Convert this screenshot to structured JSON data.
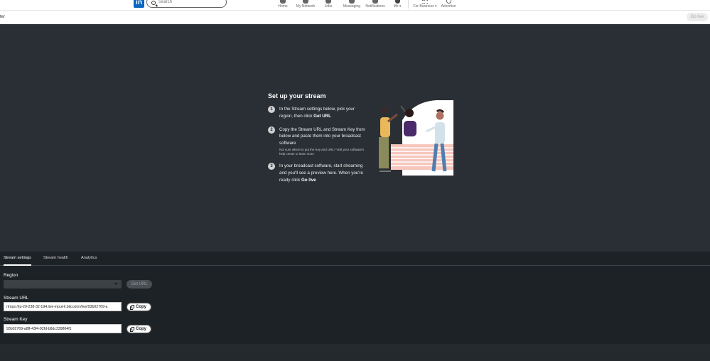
{
  "nav": {
    "logo": "in",
    "search_placeholder": "Search",
    "items": [
      {
        "label": "Home"
      },
      {
        "label": "My Network"
      },
      {
        "label": "Jobs"
      },
      {
        "label": "Messaging"
      },
      {
        "label": "Notifications"
      },
      {
        "label": "Me ▾"
      },
      {
        "label": "For Business ▾"
      },
      {
        "label": "Advertise"
      }
    ]
  },
  "subbar": {
    "title": "ter",
    "go_live": "Go live"
  },
  "setup": {
    "title": "Set up your stream",
    "steps": [
      {
        "num": "1",
        "text_a": "In the Stream settings below, pick your region, then click ",
        "bold": "Get URL",
        "text_b": ""
      },
      {
        "num": "2",
        "text_a": "Copy the Stream URL and Stream Key from below and paste them into your broadcast software",
        "bold": "",
        "text_b": "",
        "note": "Not sure where to put the Key and URL? Visit your software's help center to learn more"
      },
      {
        "num": "3",
        "text_a": "In your broadcast software, start streaming and you'll see a preview here. When you're ready click ",
        "bold": "Go live",
        "text_b": ""
      }
    ]
  },
  "colors": {
    "accent": "#0a66c2",
    "panel_bg": "#1d2226",
    "preview_bg": "#2a2f35"
  },
  "tabs": [
    {
      "label": "Stream settings",
      "active": true
    },
    {
      "label": "Stream health",
      "active": false
    },
    {
      "label": "Analytics",
      "active": false
    }
  ],
  "settings": {
    "region_label": "Region",
    "region_value": "",
    "get_url": "Get URL",
    "stream_url_label": "Stream URL",
    "stream_url_value": "rtmps://ip-20-238-32-194.live-input-li.bitcod.in/live/93b02769-a",
    "copy_label": "Copy",
    "stream_key_label": "Stream Key",
    "stream_key_value": "93b02769-a8ff-43f4-92fd-b8dc339864f1"
  }
}
